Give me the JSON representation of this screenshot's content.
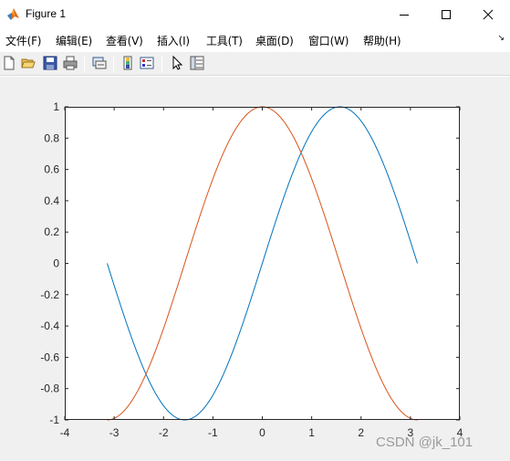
{
  "window": {
    "title": "Figure 1",
    "icon": "matlab-logo-icon"
  },
  "menu": {
    "items": [
      {
        "label": "文件(F)"
      },
      {
        "label": "编辑(E)"
      },
      {
        "label": "查看(V)"
      },
      {
        "label": "插入(I)"
      },
      {
        "label": "工具(T)"
      },
      {
        "label": "桌面(D)"
      },
      {
        "label": "窗口(W)"
      },
      {
        "label": "帮助(H)"
      }
    ],
    "overflow_icon": "chevron-right-icon"
  },
  "toolbar": {
    "buttons": [
      "new-figure-icon",
      "open-file-icon",
      "save-icon",
      "print-icon",
      "link-plot-icon",
      "insert-colorbar-icon",
      "insert-legend-icon",
      "edit-plot-icon",
      "property-inspector-icon"
    ]
  },
  "colors": {
    "sin": "#0072BD",
    "cos": "#D95319",
    "axes_bg": "#ffffff",
    "figure_bg": "#f0f0f0"
  },
  "chart_data": {
    "type": "line",
    "xlim": [
      -4,
      4
    ],
    "ylim": [
      -1,
      1
    ],
    "xticks": [
      -4,
      -3,
      -2,
      -1,
      0,
      1,
      2,
      3,
      4
    ],
    "yticks": [
      -1,
      -0.8,
      -0.6,
      -0.4,
      -0.2,
      0,
      0.2,
      0.4,
      0.6,
      0.8,
      1
    ],
    "xtick_labels": [
      "-4",
      "-3",
      "-2",
      "-1",
      "0",
      "1",
      "2",
      "3",
      "4"
    ],
    "ytick_labels": [
      "-1",
      "-0.8",
      "-0.6",
      "-0.4",
      "-0.2",
      "0",
      "0.2",
      "0.4",
      "0.6",
      "0.8",
      "1"
    ],
    "grid": false,
    "series": [
      {
        "function": "sin",
        "x_range": [
          -3.1416,
          3.1416
        ]
      },
      {
        "function": "cos",
        "x_range": [
          -3.1416,
          3.1416
        ]
      }
    ]
  },
  "watermark": "CSDN @jk_101"
}
